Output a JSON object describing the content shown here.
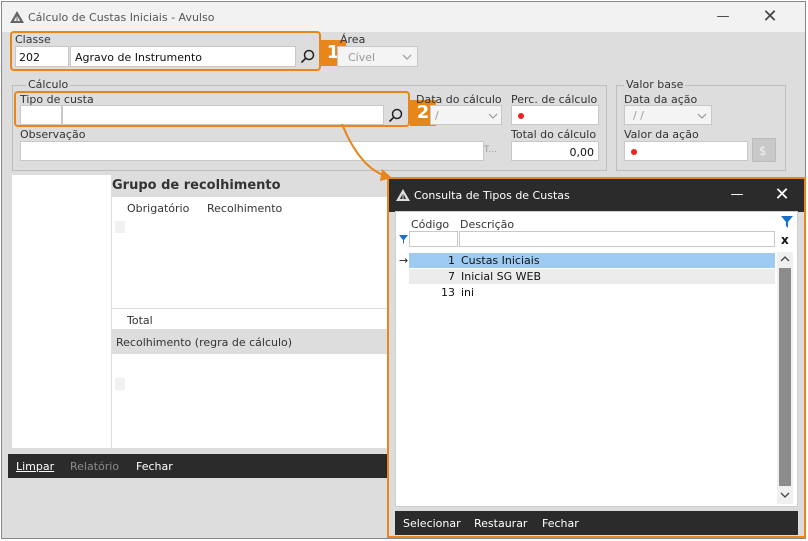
{
  "main_window": {
    "title": "Cálculo de Custas Iniciais - Avulso",
    "minimize_glyph": "—",
    "close_glyph": "✕"
  },
  "classe": {
    "label": "Classe",
    "code": "202",
    "name": "Agravo de Instrumento",
    "callout_number": "1"
  },
  "area": {
    "label": "Área",
    "value": "Cível"
  },
  "calculo": {
    "group_label": "Cálculo",
    "tipo_custa_label": "Tipo de custa",
    "tipo_custa_code": "",
    "tipo_custa_value": "",
    "callout_number": "2",
    "data_calculo_label": "Data do cálculo",
    "data_calculo_value": "/",
    "perc_calculo_label": "Perc. de cálculo",
    "observacao_label": "Observação",
    "observacao_suffix": "T...",
    "total_calculo_label": "Total do cálculo",
    "total_calculo_value": "0,00"
  },
  "valor_base": {
    "group_label": "Valor base",
    "data_acao_label": "Data da ação",
    "data_acao_value": "/ /",
    "valor_acao_label": "Valor da ação"
  },
  "grupo": {
    "title": "Grupo de recolhimento",
    "columns": [
      "Obrigatório",
      "Recolhimento"
    ],
    "total_label": "Total",
    "regra_label": "Recolhimento (regra de cálculo)"
  },
  "main_toolbar": {
    "limpar": "Limpar",
    "relatorio": "Relatório",
    "fechar": "Fechar"
  },
  "dialog": {
    "title": "Consulta de Tipos de Custas",
    "minimize_glyph": "—",
    "close_glyph": "✕",
    "columns": {
      "codigo": "Código",
      "descricao": "Descrição"
    },
    "clear_filter_glyph": "x",
    "rows": [
      {
        "codigo": "1",
        "descricao": "Custas Iniciais",
        "selected": true
      },
      {
        "codigo": "7",
        "descricao": "Inicial SG WEB",
        "selected": false
      },
      {
        "codigo": "13",
        "descricao": "ini",
        "selected": false
      }
    ],
    "toolbar": {
      "selecionar": "Selecionar",
      "restaurar": "Restaurar",
      "fechar": "Fechar"
    }
  },
  "colors": {
    "accent_orange": "#e8861a",
    "toolbar_dark": "#2b2b2b",
    "selected_row": "#9ecbf2",
    "required_dot": "#e22222"
  }
}
